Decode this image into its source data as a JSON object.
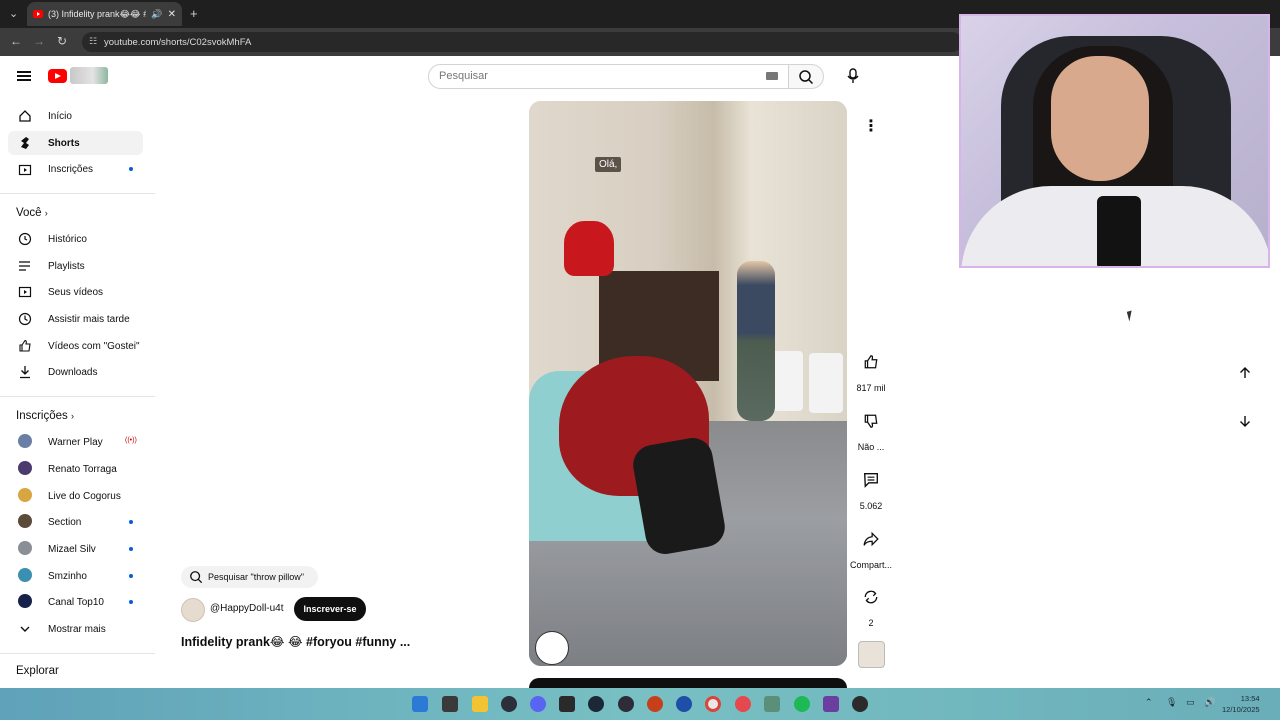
{
  "browser": {
    "tab_title": "(3) Infidelity prank😂😂 #f",
    "url": "youtube.com/shorts/C02svokMhFA"
  },
  "header": {
    "search_placeholder": "Pesquisar"
  },
  "sidebar": {
    "main_items": [
      {
        "label": "Início",
        "icon": "home-icon"
      },
      {
        "label": "Shorts",
        "icon": "shorts-icon",
        "active": true
      },
      {
        "label": "Inscrições",
        "icon": "subscriptions-icon",
        "dot": true
      }
    ],
    "you_title": "Você",
    "you_items": [
      {
        "label": "Histórico",
        "icon": "history-icon"
      },
      {
        "label": "Playlists",
        "icon": "playlist-icon"
      },
      {
        "label": "Seus vídeos",
        "icon": "video-icon"
      },
      {
        "label": "Assistir mais tarde",
        "icon": "clock-icon"
      },
      {
        "label": "Vídeos com \"Gostei\"",
        "icon": "like-icon"
      },
      {
        "label": "Downloads",
        "icon": "download-icon"
      }
    ],
    "subs_title": "Inscrições",
    "subs": [
      {
        "label": "Warner Play",
        "live": true,
        "color": "#6b7fa6"
      },
      {
        "label": "Renato Torraga",
        "color": "#4b3a6e"
      },
      {
        "label": "Live do Cogorus",
        "color": "#d8a640"
      },
      {
        "label": "Section",
        "dot": true,
        "color": "#5b4a3a"
      },
      {
        "label": "Mizael Silv",
        "dot": true,
        "color": "#8a8f96"
      },
      {
        "label": "Smzinho",
        "dot": true,
        "color": "#3b8fb0"
      },
      {
        "label": "Canal Top10",
        "dot": true,
        "color": "#16224a"
      }
    ],
    "show_more": "Mostrar mais",
    "explore_title": "Explorar"
  },
  "short": {
    "caption_overlay": "Olá,",
    "search_suggestion": "Pesquisar \"throw pillow\"",
    "channel": "@HappyDoll-u4t",
    "subscribe_label": "Inscrever-se",
    "title": "Infidelity prank😂 😂 #foryou #funny ..."
  },
  "actions": {
    "likes": "817 mil",
    "dislike": "Não ...",
    "comments": "5.062",
    "share": "Compart...",
    "remix": "2"
  },
  "taskbar": {
    "time": "13:54",
    "date": "12/10/2025"
  }
}
